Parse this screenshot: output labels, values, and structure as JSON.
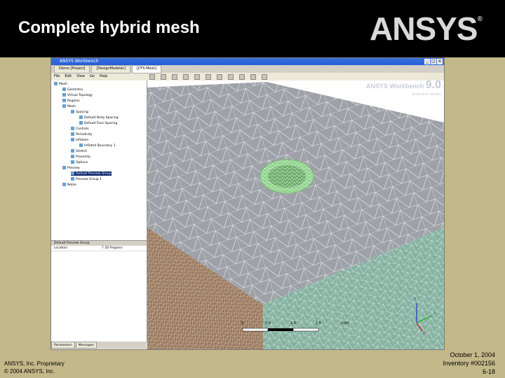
{
  "slide": {
    "title": "Complete hybrid mesh",
    "logo": "ANSYS",
    "logo_mark": "®"
  },
  "window": {
    "title": "ANSYS Workbench",
    "tabs": [
      {
        "label": "Demo [Project]"
      },
      {
        "label": "[DesignModeler]"
      },
      {
        "label": "[CFX-Mesh]"
      }
    ],
    "menu": [
      "File",
      "Edit",
      "View",
      "Go",
      "Help"
    ]
  },
  "tree": {
    "items": [
      {
        "label": "Mesh"
      },
      {
        "label": "Geometry"
      },
      {
        "label": "Virtual Topology"
      },
      {
        "label": "Regions"
      },
      {
        "label": "Mesh"
      },
      {
        "label": "Spacing"
      },
      {
        "label": "Default Body Spacing"
      },
      {
        "label": "Default Face Spacing"
      },
      {
        "label": "Controls"
      },
      {
        "label": "Periodicity"
      },
      {
        "label": "Inflation"
      },
      {
        "label": "Inflated Boundary 1"
      },
      {
        "label": "Stretch"
      },
      {
        "label": "Proximity"
      },
      {
        "label": "Options"
      },
      {
        "label": "Preview"
      },
      {
        "label": "Default Preview Group"
      },
      {
        "label": "Preview Group 1"
      },
      {
        "label": "Notes"
      }
    ]
  },
  "details": {
    "header": "Default Preview Group",
    "rows": [
      {
        "label": "Location",
        "value": "7 2D Regions"
      }
    ],
    "bottom_tabs": [
      "Parameters",
      "Messages"
    ]
  },
  "viewport": {
    "brand": "ANSYS Workbench",
    "version": "9.0",
    "sub": "Evaluation Version",
    "scale_label": "(cm)",
    "scale_ticks": [
      "0",
      "0.5",
      "1.0",
      "1.5"
    ],
    "axis_labels": [
      "Y",
      "X",
      "Z"
    ],
    "colors": {
      "top_face": "#9ea2a8",
      "right_face": "#86b2a2",
      "left_face": "#9a7a60",
      "hole": "#8fd08a"
    }
  },
  "footer": {
    "left_line1": "ANSYS, Inc. Proprietary",
    "left_line2": "© 2004 ANSYS, Inc.",
    "right_line1": "October 1, 2004",
    "right_line2": "Inventory #002156",
    "right_line3": "6-18"
  }
}
